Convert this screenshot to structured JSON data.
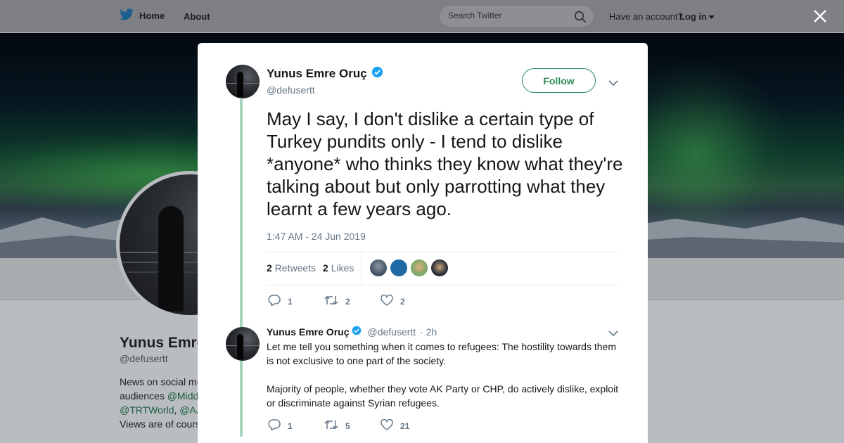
{
  "nav": {
    "home_label": "Home",
    "about_label": "About",
    "search_placeholder": "Search Twitter",
    "have_account": "Have an account?",
    "login_label": "Log in"
  },
  "colors": {
    "brand": "#2e8b5b",
    "verified": "#1da1f2",
    "thread_line": "#a5d6bd",
    "muted": "#657786"
  },
  "background_profile": {
    "name": "Yunus Emre",
    "handle": "@defusertt",
    "bio_line1": "News on social me",
    "bio_line2_prefix": "audiences ",
    "bio_line2_link": "@Midd",
    "bio_line3_link1": "@TRTWorld",
    "bio_line3_sep": ", ",
    "bio_line3_link2": "@AJ",
    "bio_line4": "Views are of cours"
  },
  "tweet": {
    "author_name": "Yunus Emre Oruç",
    "author_handle": "@defusertt",
    "follow_label": "Follow",
    "text": "May I say, I don't dislike a certain type of Turkey pundits only - I tend to dislike *anyone* who thinks they know what they're talking about but only parrotting what they learnt a few years ago.",
    "timestamp": "1:47 AM - 24 Jun 2019",
    "retweets_count": "2",
    "retweets_label": "Retweets",
    "likes_count": "2",
    "likes_label": "Likes",
    "likers": [
      "#3d4b5a",
      "#1f6aa5",
      "#7ba86a",
      "#2b2f3a"
    ],
    "actions": {
      "replies": "1",
      "retweets": "2",
      "likes": "2"
    }
  },
  "reply": {
    "author_name": "Yunus Emre Oruç",
    "author_handle": "@defusertt",
    "time": "· 2h",
    "paragraph1": "Let me tell you something when it comes to refugees: The hostility towards them is not exclusive to one part of the society.",
    "paragraph2": "Majority of people, whether they vote AK Party or CHP, do actively dislike, exploit or discriminate against Syrian refugees.",
    "actions": {
      "replies": "1",
      "retweets": "5",
      "likes": "21"
    }
  }
}
